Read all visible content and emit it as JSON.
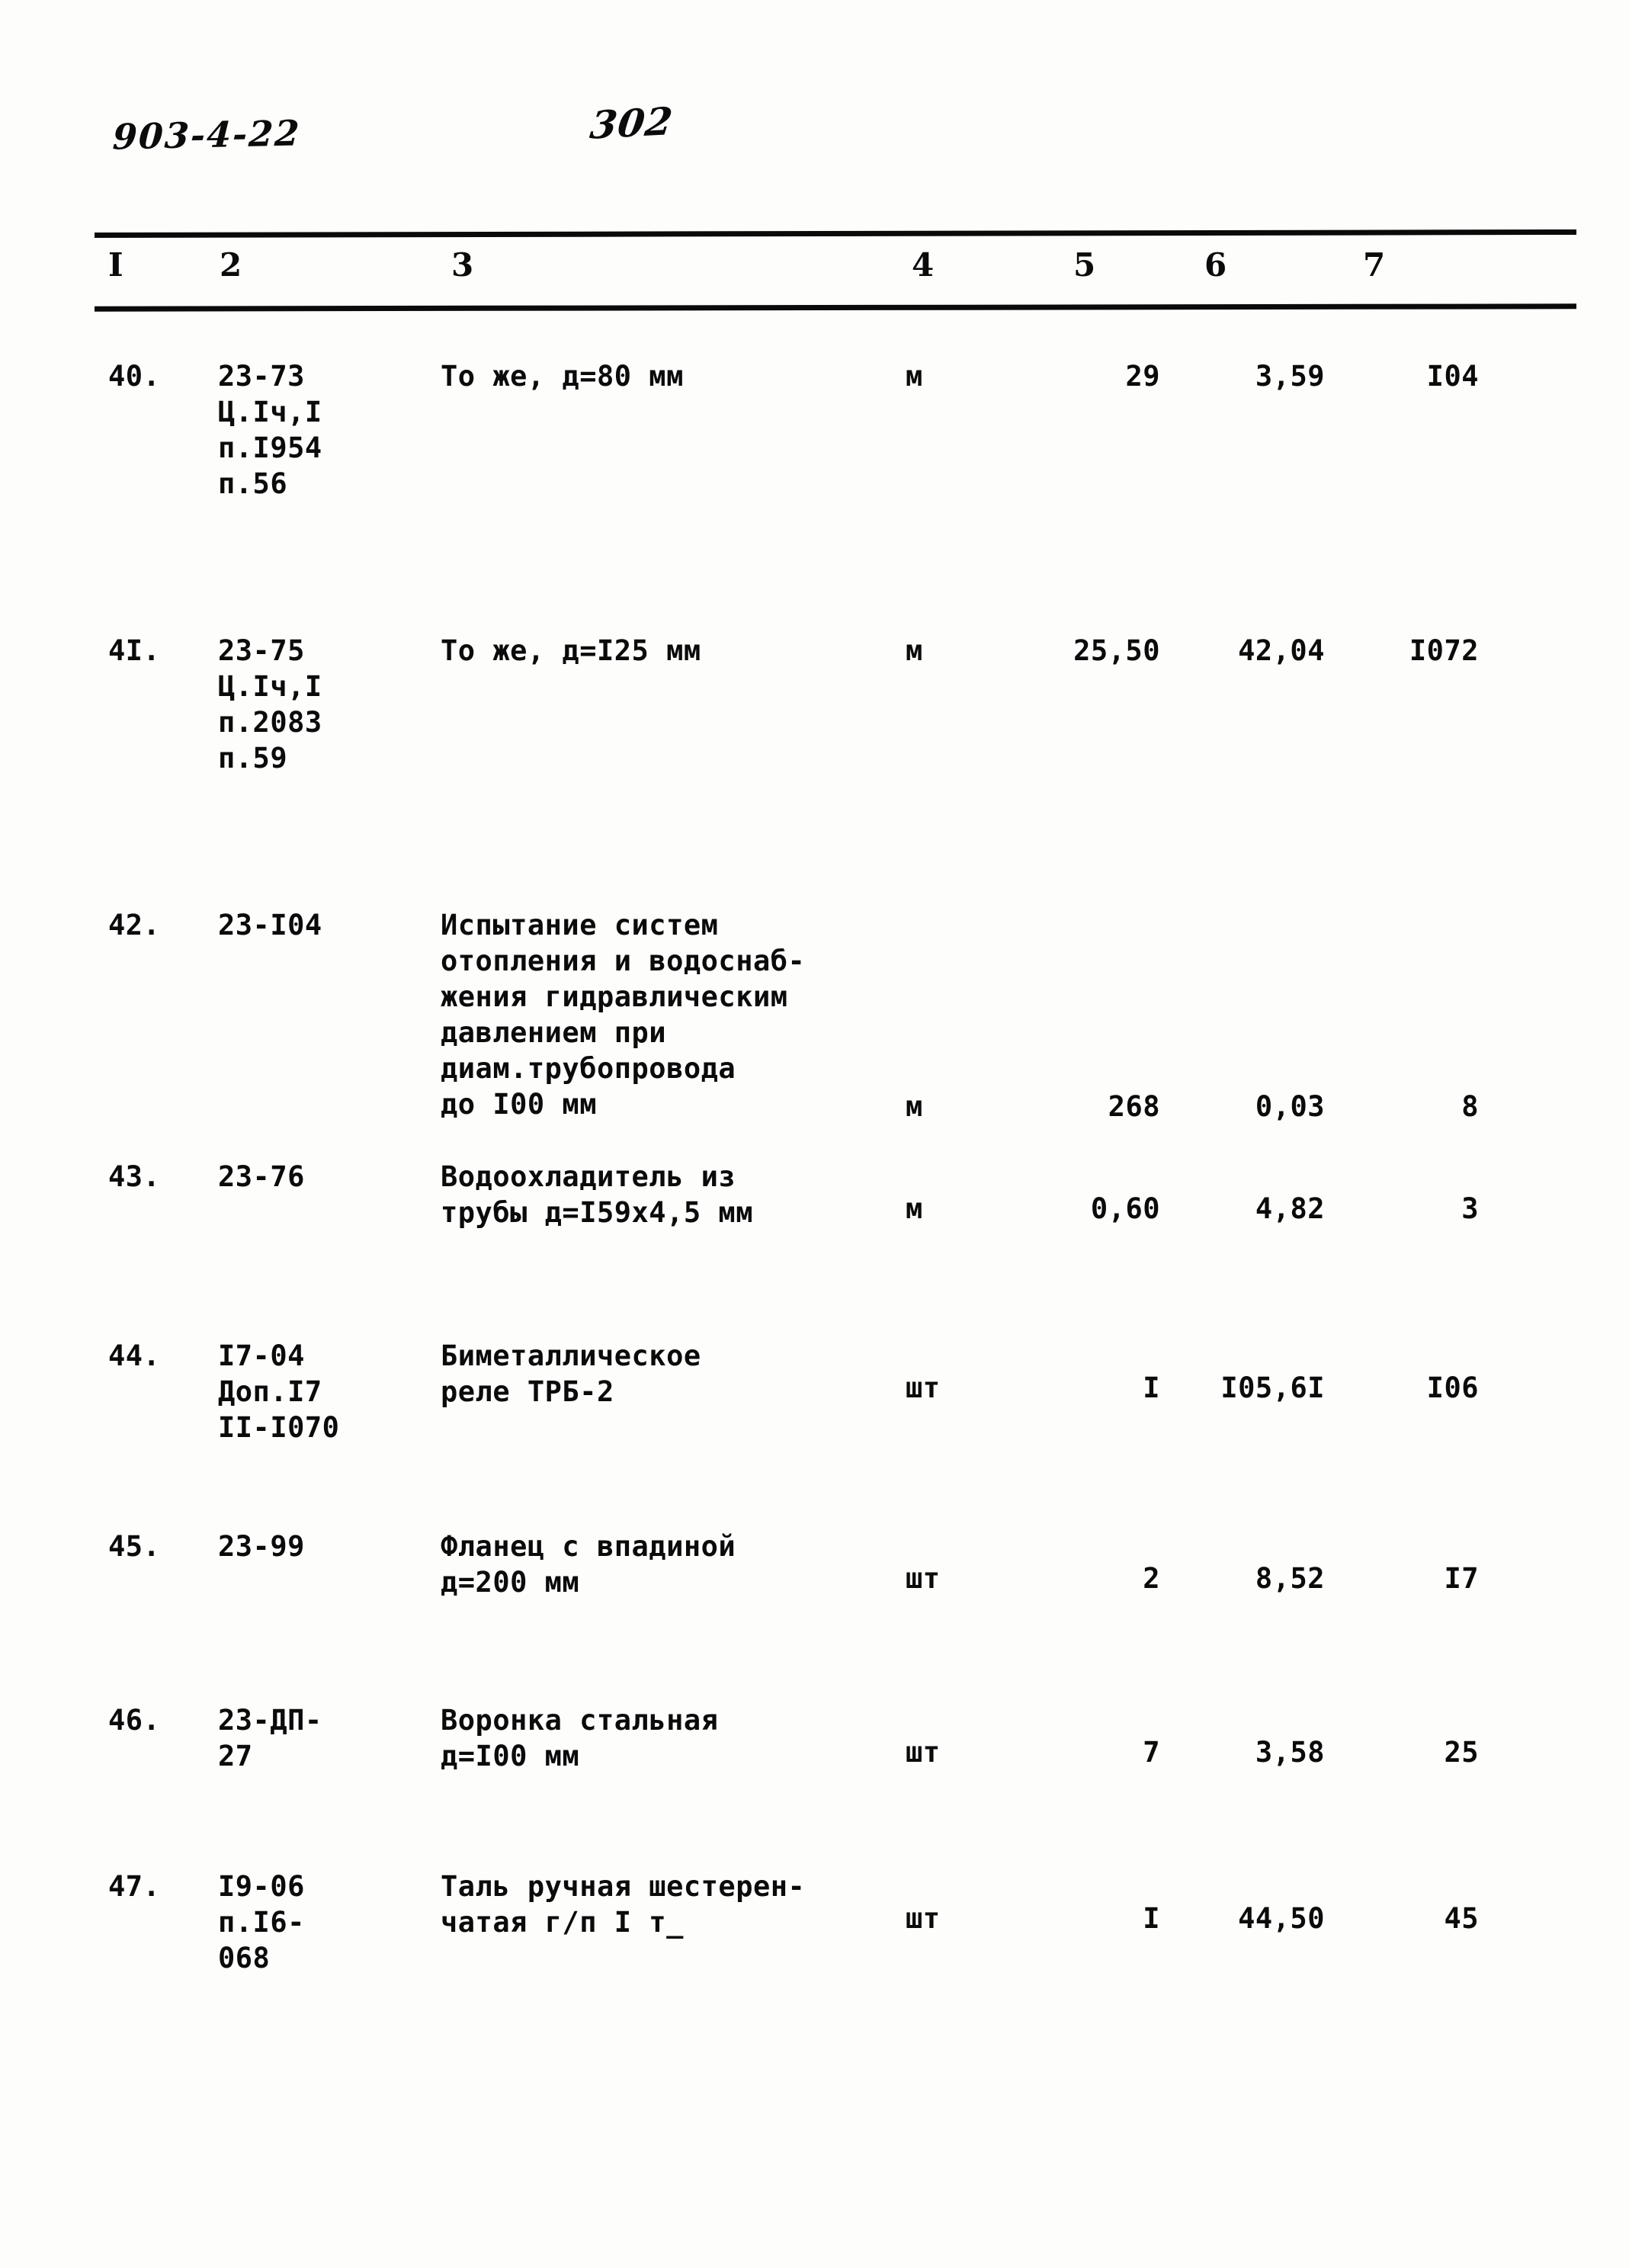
{
  "document": {
    "code": "903-4-22",
    "page_number": "302"
  },
  "table": {
    "column_headers": [
      "I",
      "2",
      "3",
      "4",
      "5",
      "6",
      "7"
    ],
    "rows": [
      {
        "num": "40.",
        "code": "23-73\nЦ.Iч,I\nп.I954\nп.56",
        "description": "То же, д=80 мм",
        "unit": "м",
        "qty": "29",
        "price": "3,59",
        "total": "I04"
      },
      {
        "num": "4I.",
        "code": "23-75\nЦ.Iч,I\nп.2083\nп.59",
        "description": "То же, д=I25 мм",
        "unit": "м",
        "qty": "25,50",
        "price": "42,04",
        "total": "I072"
      },
      {
        "num": "42.",
        "code": "23-I04",
        "description": "Испытание систем\nотопления и водоснаб-\nжения гидравлическим\nдавлением при\nдиам.трубопровода\nдо I00 мм",
        "unit": "м",
        "qty": "268",
        "price": "0,03",
        "total": "8"
      },
      {
        "num": "43.",
        "code": "23-76",
        "description": "Водоохладитель из\nтрубы д=I59х4,5 мм",
        "unit": "м",
        "qty": "0,60",
        "price": "4,82",
        "total": "3"
      },
      {
        "num": "44.",
        "code": "I7-04\nДоп.I7\nII-I070",
        "description": "Биметаллическое\nреле ТРБ-2",
        "unit": "шт",
        "qty": "I",
        "price": "I05,6I",
        "total": "I06"
      },
      {
        "num": "45.",
        "code": "23-99",
        "description": "Фланец с впадиной\nд=200 мм",
        "unit": "шт",
        "qty": "2",
        "price": "8,52",
        "total": "I7"
      },
      {
        "num": "46.",
        "code": "23-ДП-\n27",
        "description": "Воронка стальная\nд=I00 мм",
        "unit": "шт",
        "qty": "7",
        "price": "3,58",
        "total": "25"
      },
      {
        "num": "47.",
        "code": "I9-06\nп.I6-\n068",
        "description": "Таль ручная шестерен-\nчатая г/п I т_",
        "unit": "шт",
        "qty": "I",
        "price": "44,50",
        "total": "45"
      }
    ]
  }
}
